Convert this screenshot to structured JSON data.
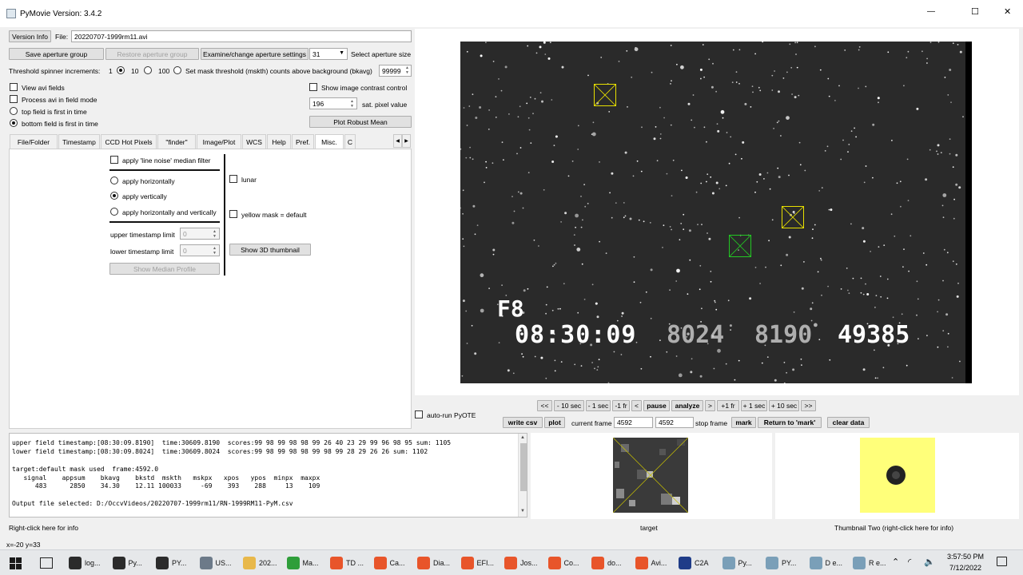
{
  "window": {
    "title": "PyMovie  Version: 3.4.2",
    "minimize_glyph": "—",
    "maximize_glyph": "☐",
    "close_glyph": "✕"
  },
  "top": {
    "version_button": "Version Info",
    "file_label": "File:",
    "file_value": "20220707-1999rm11.avi",
    "save_aperture_group": "Save aperture group",
    "restore_aperture_group": "Restore aperture group",
    "examine_aperture_settings": "Examine/change aperture settings",
    "aperture_size_value": "31",
    "aperture_size_label": "Select aperture size",
    "threshold_label": "Threshold spinner increments:",
    "inc_1": "1",
    "inc_10": "10",
    "inc_100": "100",
    "mask_threshold_label": "Set mask threshold (mskth) counts above background (bkavg)",
    "mask_threshold_value": "99999",
    "view_avi_fields": "View avi fields",
    "process_field_mode": "Process avi in field mode",
    "top_field_first": "top field is first in time",
    "bottom_field_first": "bottom field is first in time",
    "show_contrast": "Show image contrast control",
    "sat_pixel_value": "196",
    "sat_pixel_label": "sat. pixel value",
    "plot_robust_mean": "Plot Robust Mean"
  },
  "tabs": [
    {
      "label": "File/Folder",
      "active": false
    },
    {
      "label": "Timestamp",
      "active": false
    },
    {
      "label": "CCD Hot Pixels",
      "active": false
    },
    {
      "label": "\"finder\"",
      "active": false
    },
    {
      "label": "Image/Plot",
      "active": false
    },
    {
      "label": "WCS",
      "active": false
    },
    {
      "label": "Help",
      "active": false
    },
    {
      "label": "Pref.",
      "active": false
    },
    {
      "label": "Misc.",
      "active": true
    },
    {
      "label": "C",
      "active": false
    }
  ],
  "misc": {
    "line_noise_filter": "apply 'line noise' median filter",
    "apply_horizontally": "apply horizontally",
    "apply_vertically": "apply vertically",
    "apply_both": "apply horizontally and vertically",
    "upper_ts_limit": "upper timestamp limit",
    "upper_ts_value": "0",
    "lower_ts_limit": "lower timestamp limit",
    "lower_ts_value": "0",
    "show_median_profile": "Show Median Profile",
    "lunar": "lunar",
    "yellow_mask": "yellow mask = default",
    "show_3d_thumbnail": "Show 3D thumbnail"
  },
  "video": {
    "overlay_f": "F8",
    "overlay_time": "08:30:09",
    "overlay_ms1": "8024",
    "overlay_ms2": "8190",
    "overlay_frame": "49385"
  },
  "playback": {
    "buttons": [
      "<<",
      "- 10 sec",
      "- 1 sec",
      "-1 fr",
      "<",
      "pause",
      "analyze",
      ">",
      "+1 fr",
      "+ 1 sec",
      "+ 10 sec",
      ">>"
    ],
    "auto_run_pyote": "auto-run PyOTE",
    "write_csv": "write csv",
    "plot": "plot",
    "current_frame_label": "current frame",
    "current_frame_value": "4592",
    "stop_frame_value": "4592",
    "stop_frame_label": "stop frame",
    "mark": "mark",
    "return_to_mark": "Return to 'mark'",
    "clear_data": "clear data"
  },
  "log": {
    "line1": "upper field timestamp:[08:30:09.8190]  time:30609.8190  scores:99 98 99 98 98 99 26 40 23 29 99 96 98 95 sum: 1105",
    "line2": "lower field timestamp:[08:30:09.8024]  time:30609.8024  scores:99 98 99 98 98 99 98 99 28 29 26 26 sum: 1102",
    "line3": "target:default mask used  frame:4592.0",
    "line4": "   signal    appsum    bkavg    bkstd  mskth   mskpx   xpos   ypos  minpx  maxpx",
    "line5": "      483      2850    34.30    12.11 100033     -69    393    288     13    109",
    "line6": "Output file selected: D:/OccvVideos/20220707-1999rm11/RN-1999RM11-PyM.csv"
  },
  "status": {
    "right_click_info": "Right-click here for info",
    "coords": "x=-20 y=33",
    "target_label": "target",
    "thumb_two_label": "Thumbnail Two (right-click here for info)"
  },
  "taskbar": {
    "items": [
      {
        "label": "log...",
        "color": "#2b2b2b"
      },
      {
        "label": "Py...",
        "color": "#2b2b2b"
      },
      {
        "label": "PY...",
        "color": "#2b2b2b"
      },
      {
        "label": "US...",
        "color": "#6c7a89"
      },
      {
        "label": "202...",
        "color": "#e8b84a"
      },
      {
        "label": "Ma...",
        "color": "#2e9e3a"
      },
      {
        "label": "TD ...",
        "color": "#e8552a"
      },
      {
        "label": "Ca...",
        "color": "#e8552a"
      },
      {
        "label": "Dia...",
        "color": "#e8552a"
      },
      {
        "label": "EFI...",
        "color": "#e8552a"
      },
      {
        "label": "Jos...",
        "color": "#e8552a"
      },
      {
        "label": "Co...",
        "color": "#e8552a"
      },
      {
        "label": "do...",
        "color": "#e8552a"
      },
      {
        "label": "Avi...",
        "color": "#e8552a"
      },
      {
        "label": "C2A",
        "color": "#1f3c88"
      },
      {
        "label": "Py...",
        "color": "#7a9fb8"
      },
      {
        "label": "PY...",
        "color": "#7a9fb8"
      },
      {
        "label": "D e...",
        "color": "#7a9fb8"
      },
      {
        "label": "R e...",
        "color": "#7a9fb8"
      }
    ],
    "time": "3:57:50 PM",
    "date": "7/12/2022"
  }
}
